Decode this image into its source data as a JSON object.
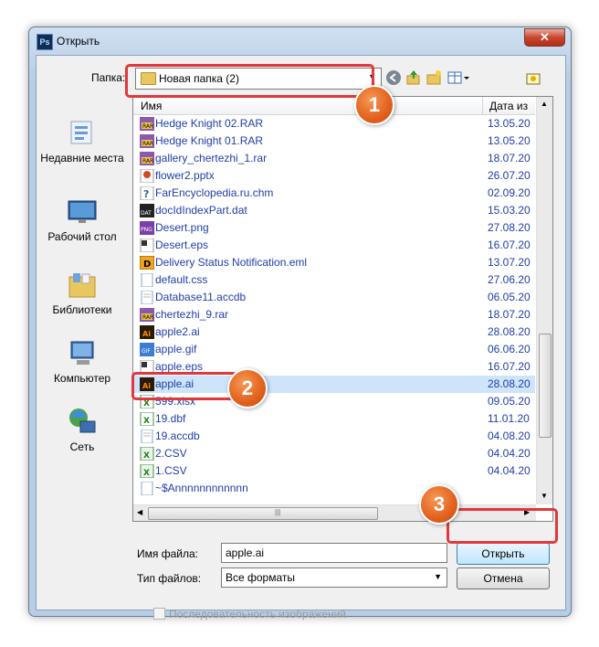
{
  "window": {
    "title": "Открыть",
    "app_icon": "Ps",
    "close": "✕"
  },
  "toolbar": {
    "folder_label": "Папка:",
    "folder_value": "Новая папка (2)"
  },
  "places": [
    {
      "label": "Недавние места",
      "icon": "recent-places-icon"
    },
    {
      "label": "Рабочий стол",
      "icon": "desktop-icon"
    },
    {
      "label": "Библиотеки",
      "icon": "libraries-icon"
    },
    {
      "label": "Компьютер",
      "icon": "computer-icon"
    },
    {
      "label": "Сеть",
      "icon": "network-icon"
    }
  ],
  "list": {
    "col_name": "Имя",
    "col_date": "Дата из",
    "rows": [
      {
        "name": "Hedge Knight 02.RAR",
        "date": "13.05.20",
        "type": "rar"
      },
      {
        "name": "Hedge Knight 01.RAR",
        "date": "13.05.20",
        "type": "rar"
      },
      {
        "name": "gallery_chertezhi_1.rar",
        "date": "18.07.20",
        "type": "rar"
      },
      {
        "name": "flower2.pptx",
        "date": "26.07.20",
        "type": "pptx"
      },
      {
        "name": "FarEncyclopedia.ru.chm",
        "date": "02.09.20",
        "type": "chm"
      },
      {
        "name": "docIdIndexPart.dat",
        "date": "15.03.20",
        "type": "dat"
      },
      {
        "name": "Desert.png",
        "date": "27.08.20",
        "type": "png"
      },
      {
        "name": "Desert.eps",
        "date": "16.07.20",
        "type": "eps"
      },
      {
        "name": "Delivery Status Notification.eml",
        "date": "13.07.20",
        "type": "eml"
      },
      {
        "name": "default.css",
        "date": "27.06.20",
        "type": "css"
      },
      {
        "name": "Database11.accdb",
        "date": "06.05.20",
        "type": "accdb"
      },
      {
        "name": "chertezhi_9.rar",
        "date": "18.07.20",
        "type": "rar"
      },
      {
        "name": "apple2.ai",
        "date": "28.08.20",
        "type": "ai"
      },
      {
        "name": "apple.gif",
        "date": "06.06.20",
        "type": "gif"
      },
      {
        "name": "apple.eps",
        "date": "16.07.20",
        "type": "eps"
      },
      {
        "name": "apple.ai",
        "date": "28.08.20",
        "type": "ai"
      },
      {
        "name": "599.xlsx",
        "date": "09.05.20",
        "type": "xlsx"
      },
      {
        "name": "19.dbf",
        "date": "11.01.20",
        "type": "xlsx"
      },
      {
        "name": "19.accdb",
        "date": "04.08.20",
        "type": "accdb"
      },
      {
        "name": "2.CSV",
        "date": "04.04.20",
        "type": "csv"
      },
      {
        "name": "1.CSV",
        "date": "04.04.20",
        "type": "csv"
      },
      {
        "name": "~$Annnnnnnnnnnn",
        "date": "",
        "type": "doc"
      }
    ],
    "selected_index": 15
  },
  "footer": {
    "filename_label": "Имя файла:",
    "filename_value": "apple.ai",
    "filetype_label": "Тип файлов:",
    "filetype_value": "Все форматы",
    "open_button": "Открыть",
    "cancel_button": "Отмена",
    "sequence_label": "Последовательность изображений"
  },
  "callouts": [
    "1",
    "2",
    "3"
  ],
  "colors": {
    "accent_red": "#e0383b",
    "callout_orange": "#e2601c",
    "link_blue": "#1f3ea8",
    "selection": "#cde4fa"
  }
}
